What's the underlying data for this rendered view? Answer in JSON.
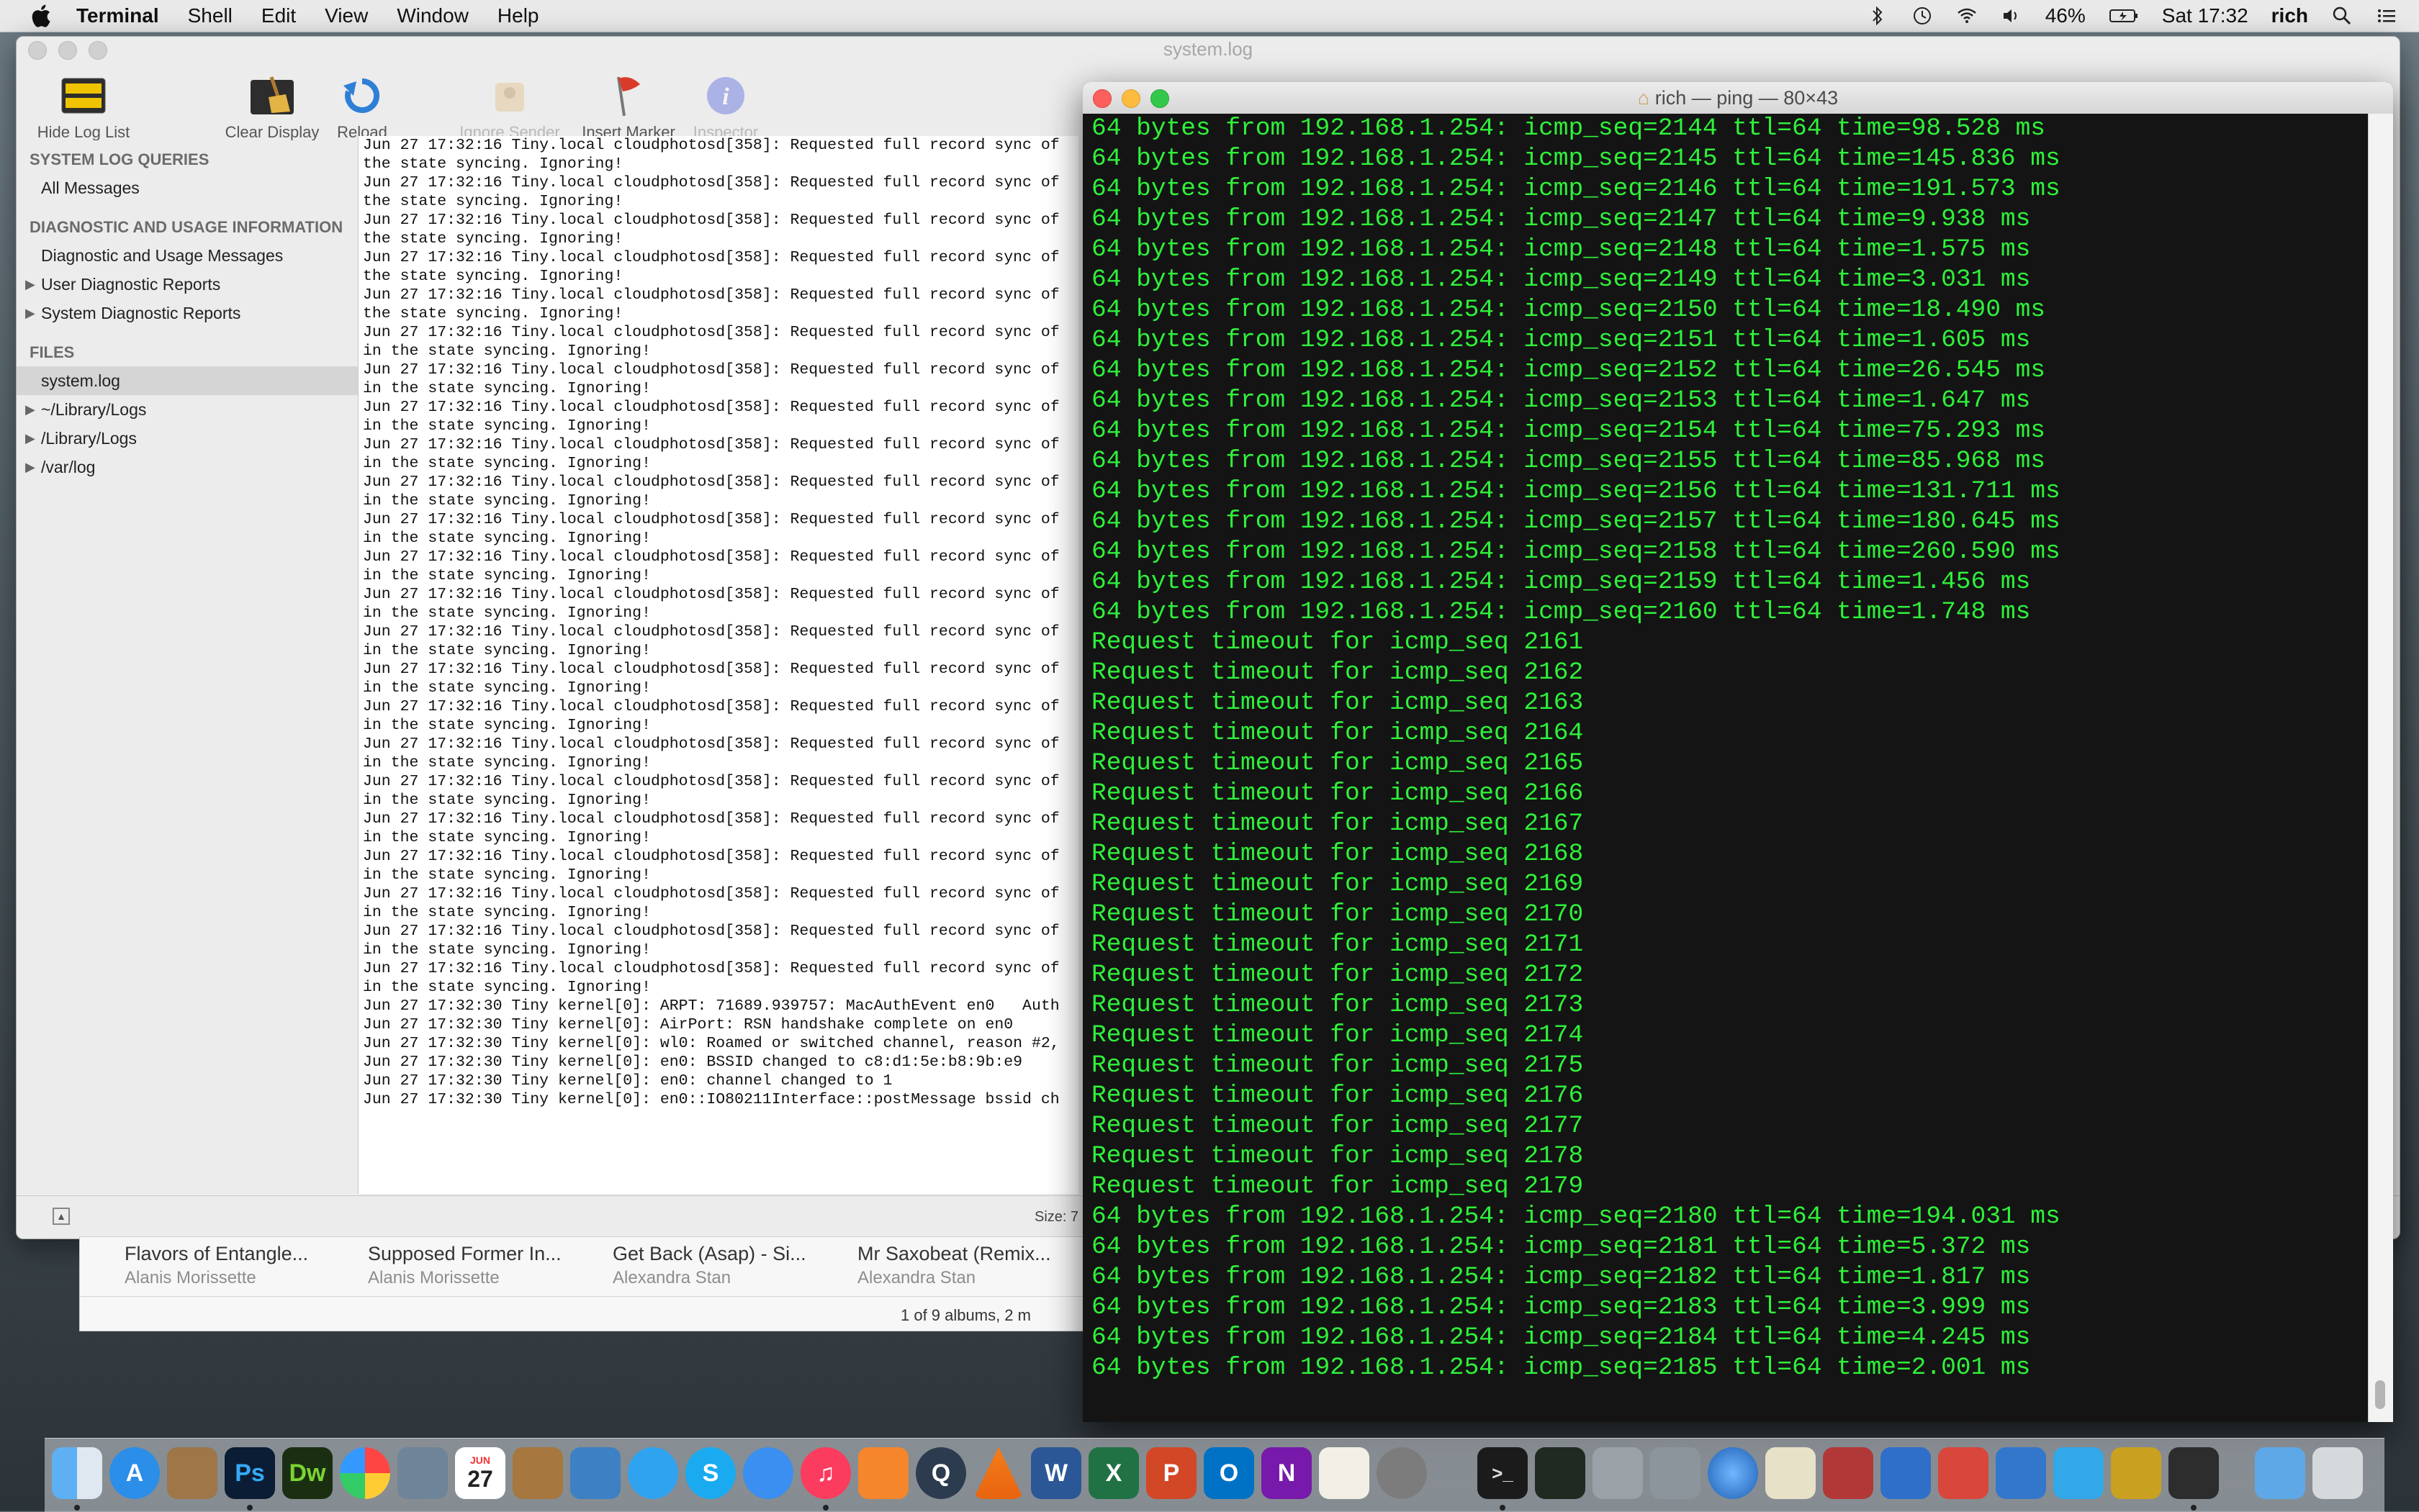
{
  "menubar": {
    "app_name": "Terminal",
    "menus": [
      "Shell",
      "Edit",
      "View",
      "Window",
      "Help"
    ],
    "battery": "46%",
    "clock": "Sat 17:32",
    "user": "rich"
  },
  "console": {
    "title": "system.log",
    "toolbar": {
      "hide_log_list": "Hide Log List",
      "clear_display": "Clear Display",
      "reload": "Reload",
      "ignore_sender": "Ignore Sender",
      "insert_marker": "Insert Marker",
      "inspector": "Inspector"
    },
    "sidebar": {
      "queries_header": "SYSTEM LOG QUERIES",
      "all_messages": "All Messages",
      "diag_header": "DIAGNOSTIC AND USAGE INFORMATION",
      "diag_messages": "Diagnostic and Usage Messages",
      "user_reports": "User Diagnostic Reports",
      "system_reports": "System Diagnostic Reports",
      "files_header": "FILES",
      "system_log": "system.log",
      "library_logs_user": "~/Library/Logs",
      "library_logs": "/Library/Logs",
      "var_log": "/var/log"
    },
    "log_lines": [
      "Jun 27 17:32:16 Tiny.local cloudphotosd[358]: Requested full record sync of",
      "the state syncing. Ignoring!",
      "Jun 27 17:32:16 Tiny.local cloudphotosd[358]: Requested full record sync of",
      "the state syncing. Ignoring!",
      "Jun 27 17:32:16 Tiny.local cloudphotosd[358]: Requested full record sync of",
      "the state syncing. Ignoring!",
      "Jun 27 17:32:16 Tiny.local cloudphotosd[358]: Requested full record sync of",
      "the state syncing. Ignoring!",
      "Jun 27 17:32:16 Tiny.local cloudphotosd[358]: Requested full record sync of",
      "the state syncing. Ignoring!",
      "Jun 27 17:32:16 Tiny.local cloudphotosd[358]: Requested full record sync of",
      "in the state syncing. Ignoring!",
      "Jun 27 17:32:16 Tiny.local cloudphotosd[358]: Requested full record sync of",
      "in the state syncing. Ignoring!",
      "Jun 27 17:32:16 Tiny.local cloudphotosd[358]: Requested full record sync of",
      "in the state syncing. Ignoring!",
      "Jun 27 17:32:16 Tiny.local cloudphotosd[358]: Requested full record sync of",
      "in the state syncing. Ignoring!",
      "Jun 27 17:32:16 Tiny.local cloudphotosd[358]: Requested full record sync of",
      "in the state syncing. Ignoring!",
      "Jun 27 17:32:16 Tiny.local cloudphotosd[358]: Requested full record sync of",
      "in the state syncing. Ignoring!",
      "Jun 27 17:32:16 Tiny.local cloudphotosd[358]: Requested full record sync of",
      "in the state syncing. Ignoring!",
      "Jun 27 17:32:16 Tiny.local cloudphotosd[358]: Requested full record sync of",
      "in the state syncing. Ignoring!",
      "Jun 27 17:32:16 Tiny.local cloudphotosd[358]: Requested full record sync of",
      "in the state syncing. Ignoring!",
      "Jun 27 17:32:16 Tiny.local cloudphotosd[358]: Requested full record sync of",
      "in the state syncing. Ignoring!",
      "Jun 27 17:32:16 Tiny.local cloudphotosd[358]: Requested full record sync of",
      "in the state syncing. Ignoring!",
      "Jun 27 17:32:16 Tiny.local cloudphotosd[358]: Requested full record sync of",
      "in the state syncing. Ignoring!",
      "Jun 27 17:32:16 Tiny.local cloudphotosd[358]: Requested full record sync of",
      "in the state syncing. Ignoring!",
      "Jun 27 17:32:16 Tiny.local cloudphotosd[358]: Requested full record sync of",
      "in the state syncing. Ignoring!",
      "Jun 27 17:32:16 Tiny.local cloudphotosd[358]: Requested full record sync of",
      "in the state syncing. Ignoring!",
      "Jun 27 17:32:16 Tiny.local cloudphotosd[358]: Requested full record sync of",
      "in the state syncing. Ignoring!",
      "Jun 27 17:32:16 Tiny.local cloudphotosd[358]: Requested full record sync of",
      "in the state syncing. Ignoring!",
      "Jun 27 17:32:16 Tiny.local cloudphotosd[358]: Requested full record sync of",
      "in the state syncing. Ignoring!",
      "Jun 27 17:32:30 Tiny kernel[0]: ARPT: 71689.939757: MacAuthEvent en0   Auth",
      "Jun 27 17:32:30 Tiny kernel[0]: AirPort: RSN handshake complete on en0",
      "Jun 27 17:32:30 Tiny kernel[0]: wl0: Roamed or switched channel, reason #2,",
      "Jun 27 17:32:30 Tiny kernel[0]: en0: BSSID changed to c8:d1:5e:b8:9b:e9",
      "Jun 27 17:32:30 Tiny kernel[0]: en0: channel changed to 1",
      "Jun 27 17:32:30 Tiny kernel[0]: en0::IO80211Interface::postMessage bssid ch"
    ],
    "size_label": "Size: 7"
  },
  "itunes": {
    "albums": [
      {
        "title": "Flavors of Entangle...",
        "artist": "Alanis Morissette"
      },
      {
        "title": "Supposed Former In...",
        "artist": "Alanis Morissette"
      },
      {
        "title": "Get Back (Asap) - Si...",
        "artist": "Alexandra Stan"
      },
      {
        "title": "Mr Saxobeat (Remix...",
        "artist": "Alexandra Stan"
      }
    ],
    "count": "1 of 9 albums, 2 m"
  },
  "terminal": {
    "title": "rich — ping — 80×43",
    "lines": [
      "64 bytes from 192.168.1.254: icmp_seq=2144 ttl=64 time=98.528 ms",
      "64 bytes from 192.168.1.254: icmp_seq=2145 ttl=64 time=145.836 ms",
      "64 bytes from 192.168.1.254: icmp_seq=2146 ttl=64 time=191.573 ms",
      "64 bytes from 192.168.1.254: icmp_seq=2147 ttl=64 time=9.938 ms",
      "64 bytes from 192.168.1.254: icmp_seq=2148 ttl=64 time=1.575 ms",
      "64 bytes from 192.168.1.254: icmp_seq=2149 ttl=64 time=3.031 ms",
      "64 bytes from 192.168.1.254: icmp_seq=2150 ttl=64 time=18.490 ms",
      "64 bytes from 192.168.1.254: icmp_seq=2151 ttl=64 time=1.605 ms",
      "64 bytes from 192.168.1.254: icmp_seq=2152 ttl=64 time=26.545 ms",
      "64 bytes from 192.168.1.254: icmp_seq=2153 ttl=64 time=1.647 ms",
      "64 bytes from 192.168.1.254: icmp_seq=2154 ttl=64 time=75.293 ms",
      "64 bytes from 192.168.1.254: icmp_seq=2155 ttl=64 time=85.968 ms",
      "64 bytes from 192.168.1.254: icmp_seq=2156 ttl=64 time=131.711 ms",
      "64 bytes from 192.168.1.254: icmp_seq=2157 ttl=64 time=180.645 ms",
      "64 bytes from 192.168.1.254: icmp_seq=2158 ttl=64 time=260.590 ms",
      "64 bytes from 192.168.1.254: icmp_seq=2159 ttl=64 time=1.456 ms",
      "64 bytes from 192.168.1.254: icmp_seq=2160 ttl=64 time=1.748 ms",
      "Request timeout for icmp_seq 2161",
      "Request timeout for icmp_seq 2162",
      "Request timeout for icmp_seq 2163",
      "Request timeout for icmp_seq 2164",
      "Request timeout for icmp_seq 2165",
      "Request timeout for icmp_seq 2166",
      "Request timeout for icmp_seq 2167",
      "Request timeout for icmp_seq 2168",
      "Request timeout for icmp_seq 2169",
      "Request timeout for icmp_seq 2170",
      "Request timeout for icmp_seq 2171",
      "Request timeout for icmp_seq 2172",
      "Request timeout for icmp_seq 2173",
      "Request timeout for icmp_seq 2174",
      "Request timeout for icmp_seq 2175",
      "Request timeout for icmp_seq 2176",
      "Request timeout for icmp_seq 2177",
      "Request timeout for icmp_seq 2178",
      "Request timeout for icmp_seq 2179",
      "64 bytes from 192.168.1.254: icmp_seq=2180 ttl=64 time=194.031 ms",
      "64 bytes from 192.168.1.254: icmp_seq=2181 ttl=64 time=5.372 ms",
      "64 bytes from 192.168.1.254: icmp_seq=2182 ttl=64 time=1.817 ms",
      "64 bytes from 192.168.1.254: icmp_seq=2183 ttl=64 time=3.999 ms",
      "64 bytes from 192.168.1.254: icmp_seq=2184 ttl=64 time=4.245 ms",
      "64 bytes from 192.168.1.254: icmp_seq=2185 ttl=64 time=2.001 ms"
    ]
  },
  "dock": {
    "labels": {
      "photoshop": "Ps",
      "dreamweaver": "Dw",
      "calendar_month": "JUN",
      "calendar_day": "27",
      "word": "W",
      "excel": "X",
      "powerpoint": "P",
      "outlook": "O",
      "onenote": "N",
      "terminal_prompt": ">_"
    }
  },
  "colors": {
    "terminal_text": "#2ff13a",
    "terminal_bg": "#141414",
    "menubar_bg": "#e9e9ea"
  }
}
